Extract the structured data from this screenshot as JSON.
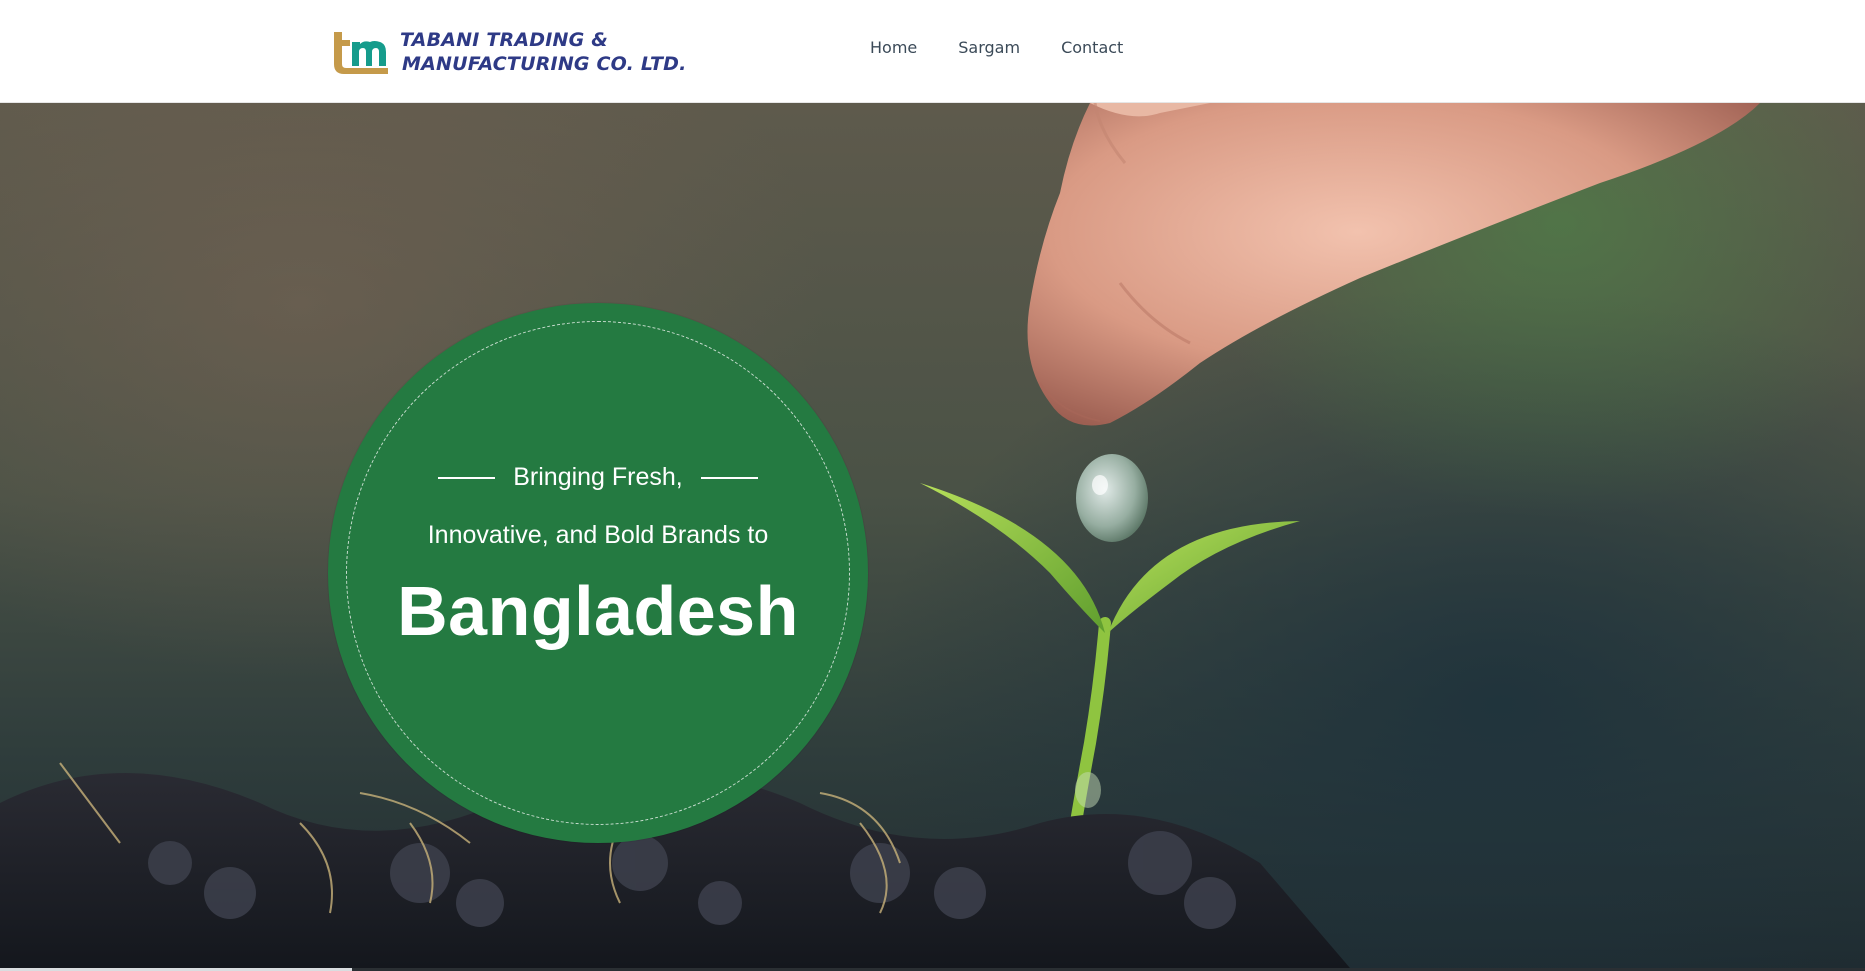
{
  "brand": {
    "name_line1": "TABANI TRADING &",
    "name_line2": "MANUFACTURING CO. LTD.",
    "mark_text": "tm",
    "colors": {
      "gold": "#c59a4a",
      "teal": "#169c8c",
      "navy": "#2e3a86"
    }
  },
  "nav": {
    "items": [
      {
        "label": "Home"
      },
      {
        "label": "Sargam"
      },
      {
        "label": "Contact"
      }
    ]
  },
  "hero": {
    "line1": "Bringing Fresh,",
    "line2": "Innovative, and Bold Brands to",
    "line3": "Bangladesh",
    "circle_color": "#247a41"
  }
}
